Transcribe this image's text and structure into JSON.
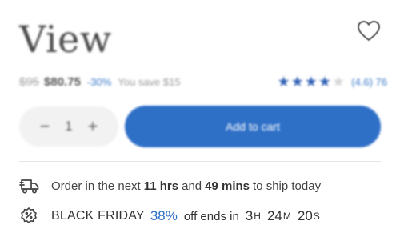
{
  "product": {
    "title": "View"
  },
  "pricing": {
    "original_price": "$95",
    "sale_price": "$80.75",
    "discount": "-30%",
    "savings": "You save $15"
  },
  "rating": {
    "stars_filled": 4,
    "stars_total": 5,
    "label": "(4.6) 76",
    "star_color": "#2f5fb3"
  },
  "purchase": {
    "quantity": "1",
    "minus_symbol": "−",
    "plus_symbol": "+",
    "add_to_cart_label": "Add to cart",
    "button_color": "#2f70c7"
  },
  "shipping": {
    "prefix": "Order in the next",
    "hours": "11 hrs",
    "and": "and",
    "minutes": "49 mins",
    "suffix": "to ship today",
    "icon": "delivery-truck-icon"
  },
  "promo": {
    "label": "BLACK FRIDAY",
    "percent": "38%",
    "text": "off ends in",
    "hours": "3",
    "hours_unit": "H",
    "minutes": "24",
    "minutes_unit": "M",
    "seconds": "20",
    "seconds_unit": "S",
    "icon": "discount-badge-icon"
  }
}
